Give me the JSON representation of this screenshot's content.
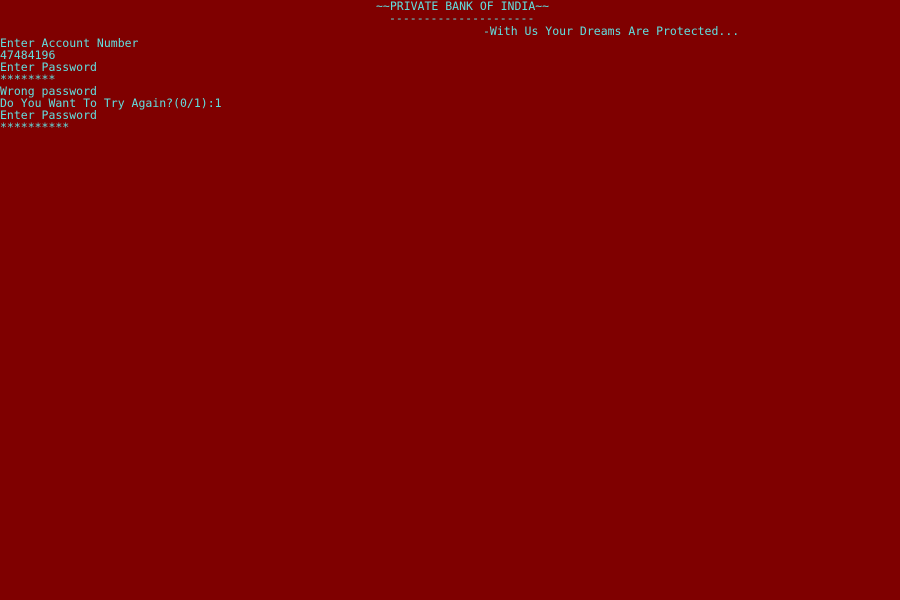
{
  "header": {
    "title": "~~PRIVATE BANK OF INDIA~~",
    "underline": "---------------------",
    "tagline": "-With Us Your Dreams Are Protected..."
  },
  "console": {
    "prompt_account": "Enter Account Number",
    "account_number": "47484196",
    "prompt_password_1": "Enter Password",
    "password_mask_1": "********",
    "error_message": "Wrong password",
    "retry_prompt": "Do You Want To Try Again?(0/1):1",
    "prompt_password_2": "Enter Password",
    "password_mask_2": "**********"
  },
  "colors": {
    "background": "#7f0000",
    "text": "#62dede"
  }
}
